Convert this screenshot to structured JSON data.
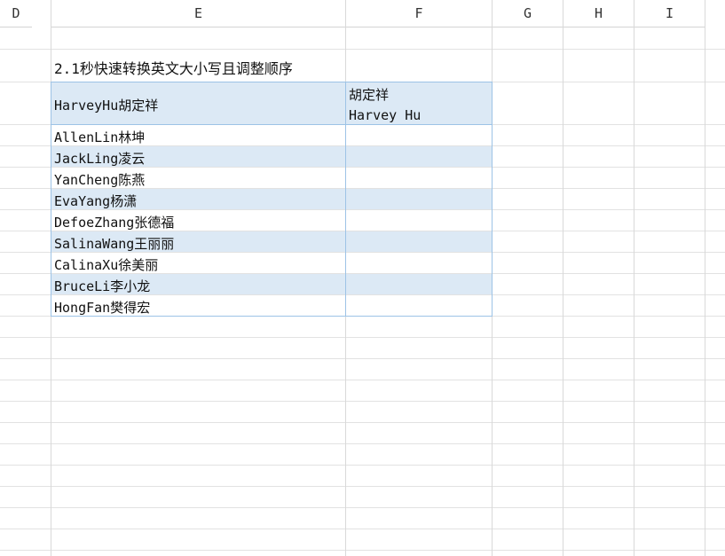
{
  "columns": [
    "D",
    "E",
    "F",
    "G",
    "H",
    "I"
  ],
  "title": "2.1秒快速转换英文大小写且调整顺序",
  "header_row": {
    "e": "HarveyHu胡定祥",
    "f_line1": "胡定祥",
    "f_line2": "Harvey Hu"
  },
  "rows": [
    "AllenLin林坤",
    "JackLing凌云",
    "YanCheng陈燕",
    "EvaYang杨潇",
    "DefoeZhang张德福",
    "SalinaWang王丽丽",
    "CalinaXu徐美丽",
    "BruceLi李小龙",
    "HongFan樊得宏"
  ],
  "colors": {
    "band": "#dce9f5",
    "table_border": "#9dc3e6",
    "gridline": "#d9d9d9"
  }
}
